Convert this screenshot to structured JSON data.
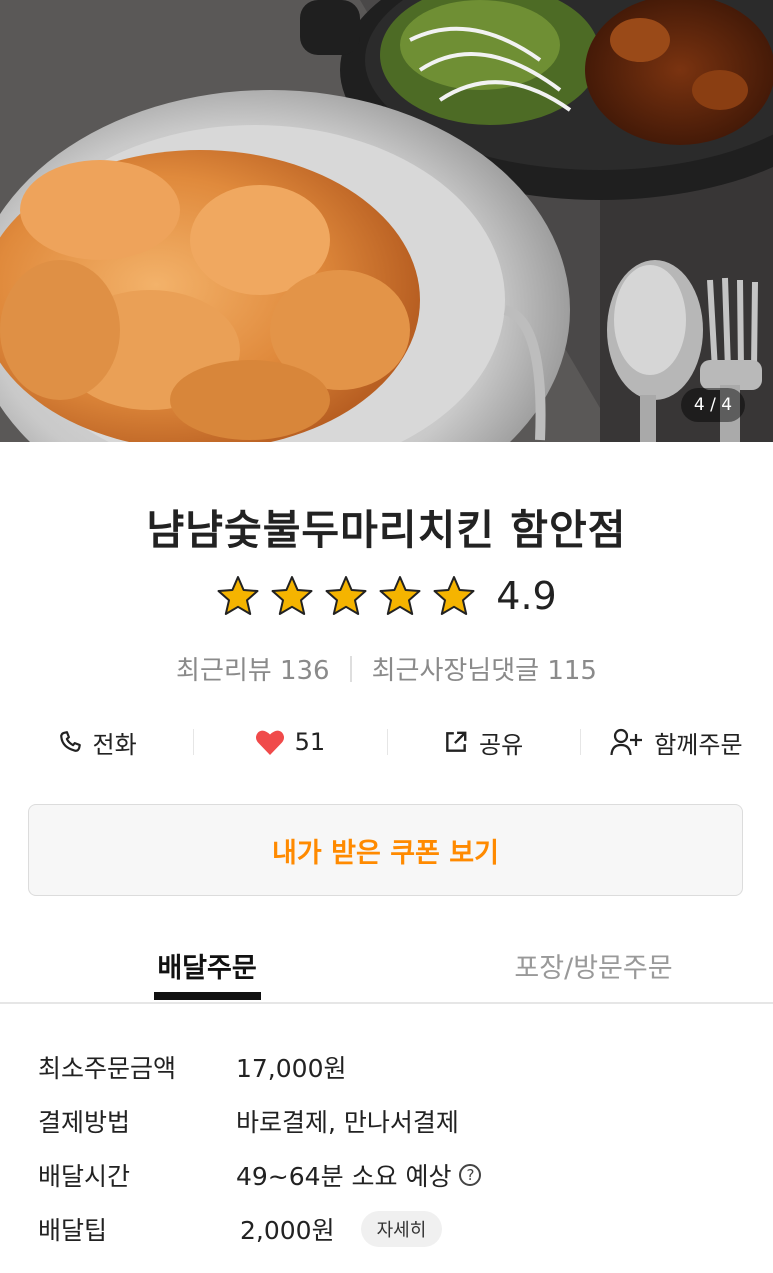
{
  "hero": {
    "counter": "4 / 4"
  },
  "store": {
    "name": "냠냠숯불두마리치킨 함안점",
    "rating": "4.9",
    "star_count": 5,
    "recent_reviews": "최근리뷰 136",
    "owner_replies": "최근사장님댓글 115"
  },
  "actions": {
    "call": "전화",
    "likes": "51",
    "share": "공유",
    "group_order": "함께주문"
  },
  "coupon": {
    "label": "내가 받은 쿠폰 보기"
  },
  "tabs": {
    "delivery": "배달주문",
    "pickup": "포장/방문주문"
  },
  "info": [
    {
      "label": "최소주문금액",
      "value": "17,000원"
    },
    {
      "label": "결제방법",
      "value": "바로결제, 만나서결제"
    },
    {
      "label": "배달시간",
      "value": "49~64분 소요 예상",
      "help": "?"
    },
    {
      "label": "배달팁",
      "value": "2,000원",
      "button": "자세히"
    }
  ],
  "colors": {
    "accent": "#ff8a00",
    "heart": "#f04a4a",
    "star": "#f5b400"
  }
}
